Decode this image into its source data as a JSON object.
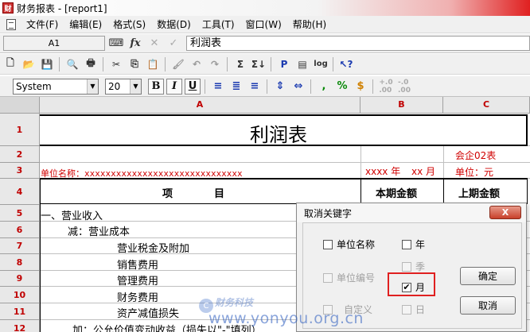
{
  "window": {
    "title": "财务报表 - [report1]",
    "app_icon": "finance-app-icon"
  },
  "menu": {
    "items": [
      "文件(F)",
      "编辑(E)",
      "格式(S)",
      "数据(D)",
      "工具(T)",
      "窗口(W)",
      "帮助(H)"
    ]
  },
  "formula_bar": {
    "cell_ref": "A1",
    "value": "利润表"
  },
  "format_bar": {
    "font": "System",
    "size": "20"
  },
  "columns": [
    "A",
    "B",
    "C"
  ],
  "rows": [
    "1",
    "2",
    "3",
    "4",
    "5",
    "6",
    "7",
    "8",
    "9",
    "10",
    "11",
    "12"
  ],
  "report": {
    "title": "利润表",
    "form_code": "会企02表",
    "unit_name": "单位名称：xxxxxxxxxxxxxxxxxxxxxxxxxxxxxx",
    "date_year": "xxxx 年",
    "date_month": "xx 月",
    "currency_unit": "单位：元",
    "header_item": "项　　　　目",
    "header_current": "本期金额",
    "header_previous": "上期金额",
    "items": [
      "一、营业收入",
      "减：营业成本",
      "营业税金及附加",
      "销售费用",
      "管理费用",
      "财务费用",
      "资产减值损失",
      "加：公允价值变动收益（损失以\"-\"填列）"
    ]
  },
  "dialog": {
    "title": "取消关键字",
    "close": "X",
    "checkboxes": {
      "unit_name": {
        "label": "单位名称",
        "checked": false,
        "enabled": true
      },
      "year": {
        "label": "年",
        "checked": false,
        "enabled": true
      },
      "quarter": {
        "label": "季",
        "checked": false,
        "enabled": false
      },
      "unit_code": {
        "label": "单位编号",
        "checked": false,
        "enabled": false
      },
      "month": {
        "label": "月",
        "checked": true,
        "enabled": true
      },
      "custom": {
        "label": "自定义",
        "checked": false,
        "enabled": false
      },
      "day": {
        "label": "日",
        "checked": false,
        "enabled": false
      }
    },
    "ok_label": "确定",
    "cancel_label": "取消"
  },
  "watermark": {
    "brand": "财务科技",
    "url": "www.yonyou.org.cn",
    "logo": "C"
  }
}
